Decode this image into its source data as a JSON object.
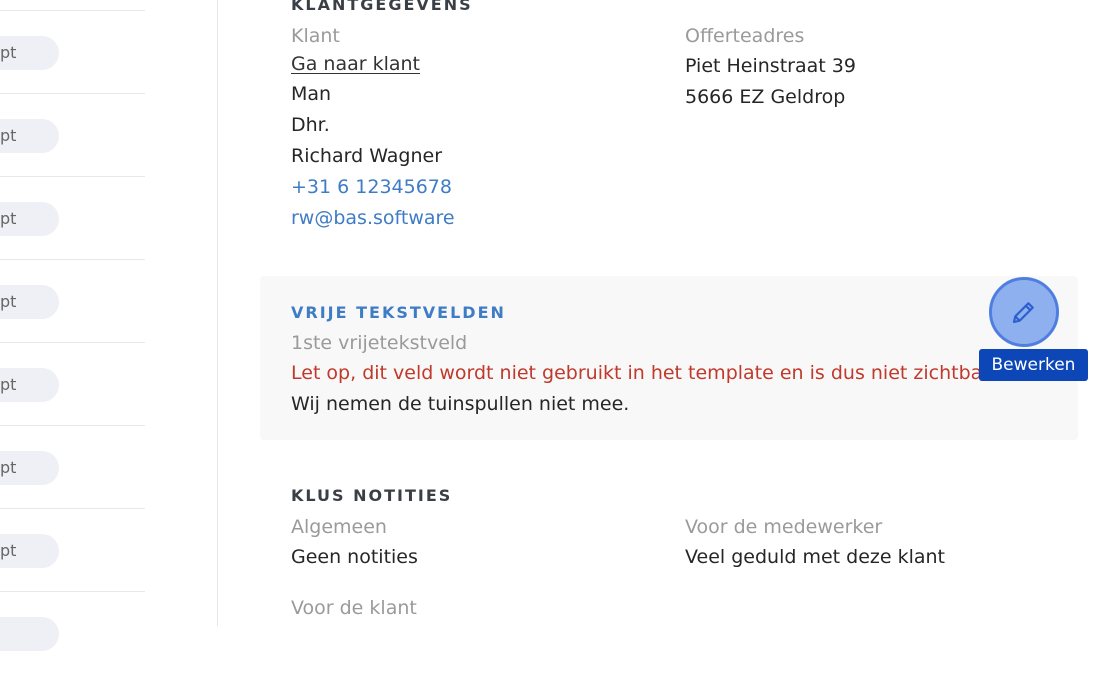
{
  "left_list": {
    "pill_label": "pt",
    "rows": 8
  },
  "klant": {
    "section_title": "KLANTGEGEVENS",
    "klant_label": "Klant",
    "klant_link": "Ga naar klant",
    "gender": "Man",
    "salutation": "Dhr.",
    "name": "Richard Wagner",
    "phone": "+31 6 12345678",
    "email": "rw@bas.software",
    "address_label": "Offerteadres",
    "address_line1": "Piet Heinstraat 39",
    "address_line2": "5666 EZ Geldrop"
  },
  "free_fields": {
    "section_title": "VRIJE TEKSTVELDEN",
    "field_label": "1ste vrijetekstveld",
    "warning": "Let op, dit veld wordt niet gebruikt in het template en is dus niet zichtbaar",
    "value": "Wij nemen de tuinspullen niet mee.",
    "edit_tooltip": "Bewerken"
  },
  "notes": {
    "section_title": "KLUS NOTITIES",
    "general_label": "Algemeen",
    "general_value": "Geen notities",
    "employee_label": "Voor de medewerker",
    "employee_value": "Veel geduld met deze klant",
    "customer_label": "Voor de klant"
  },
  "colors": {
    "accent_blue": "#3f7cc6",
    "warning_red": "#c0392b",
    "tooltip_bg": "#0d47b7"
  }
}
